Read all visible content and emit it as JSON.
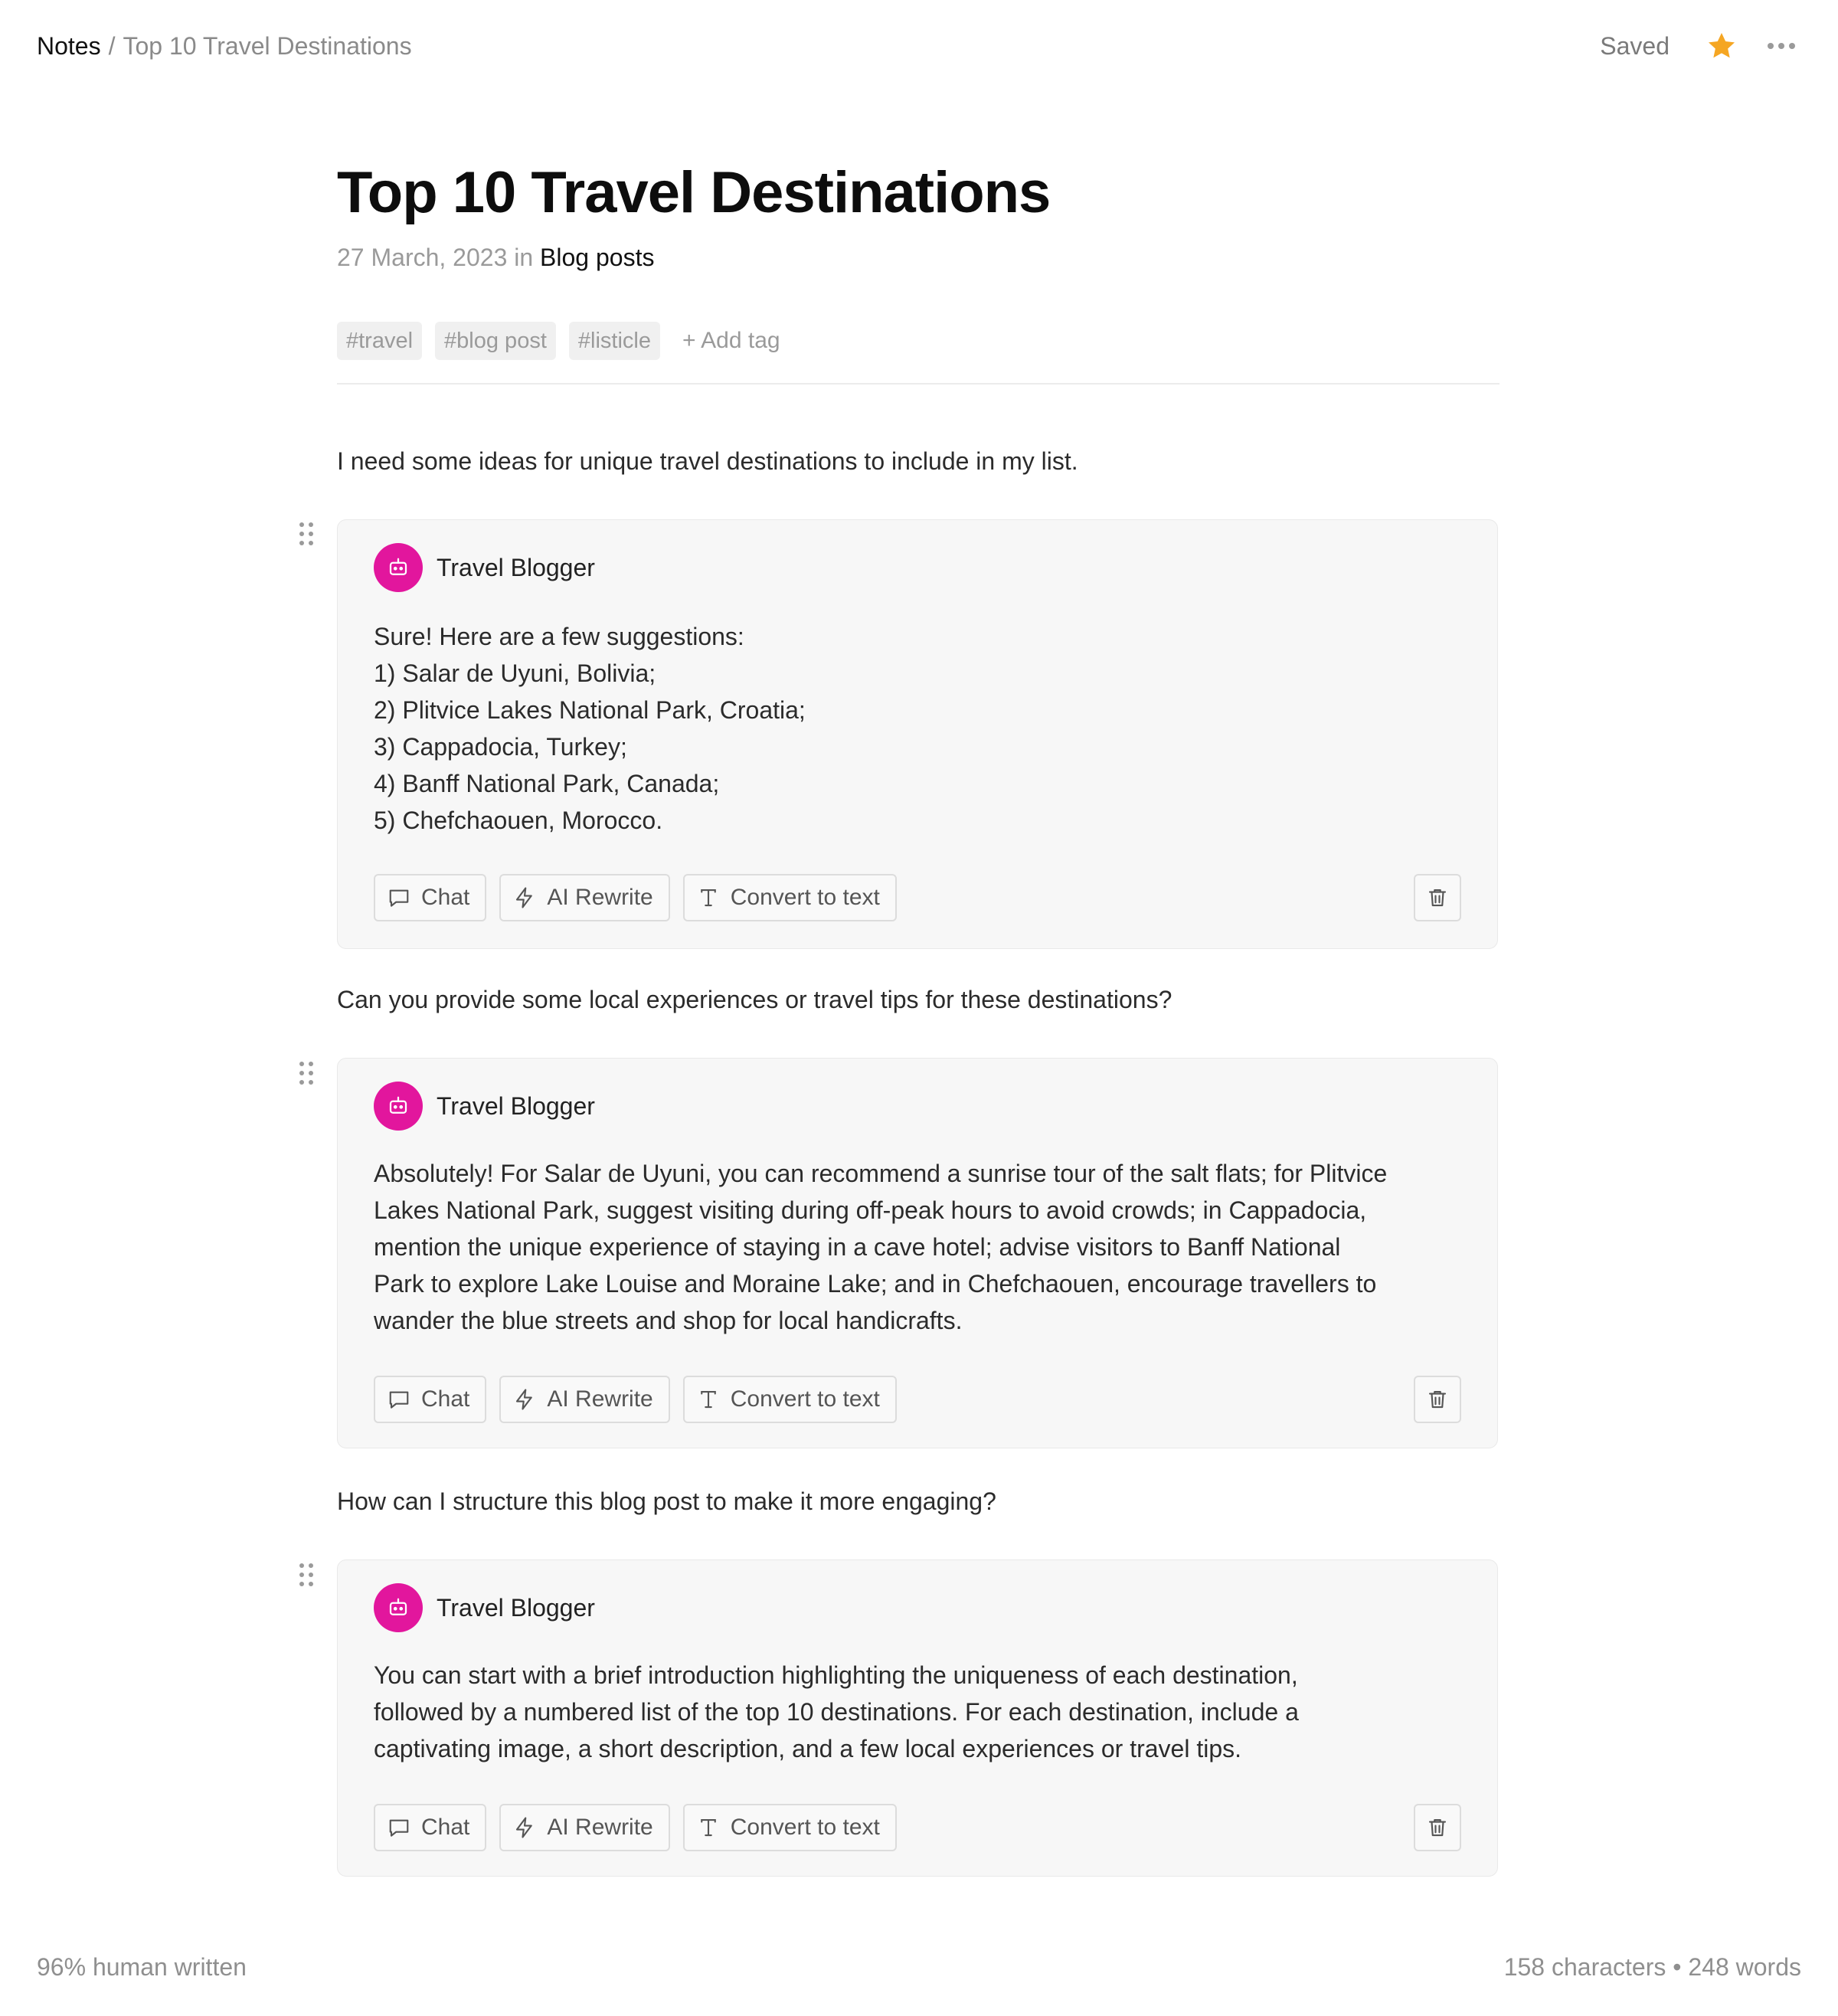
{
  "breadcrumb": {
    "root": "Notes",
    "separator": "/",
    "current": "Top 10 Travel Destinations"
  },
  "status": {
    "saved": "Saved",
    "starred": true,
    "star_color": "#F5A623"
  },
  "document": {
    "title": "Top 10 Travel Destinations",
    "date": "27 March, 2023",
    "in_word": "in",
    "category": "Blog posts",
    "tags": [
      "#travel",
      "#blog post",
      "#listicle"
    ],
    "add_tag": "+ Add tag"
  },
  "accent_color": "#E2169D",
  "blocks": [
    {
      "prompt": "I need some ideas for unique travel destinations to include in my list.",
      "bot_name": "Travel Blogger",
      "bot_icon": "robot-icon",
      "response_lines": [
        "Sure! Here are a few suggestions:",
        "1) Salar de Uyuni, Bolivia;",
        "2) Plitvice Lakes National Park, Croatia;",
        "3) Cappadocia, Turkey;",
        "4) Banff National Park, Canada;",
        "5) Chefchaouen, Morocco."
      ],
      "actions": {
        "chat": "Chat",
        "rewrite": "AI Rewrite",
        "convert": "Convert to text"
      }
    },
    {
      "prompt": "Can you provide some local experiences or travel tips for these destinations?",
      "bot_name": "Travel Blogger",
      "bot_icon": "robot-icon",
      "response_lines": [
        "Absolutely! For Salar de Uyuni, you can recommend a sunrise tour of the salt flats; for Plitvice",
        "Lakes National Park, suggest visiting during off-peak hours to avoid crowds; in Cappadocia,",
        "mention the unique experience of staying in a cave hotel; advise visitors to Banff National",
        "Park to explore Lake Louise and Moraine Lake; and in Chefchaouen, encourage travellers to",
        "wander the blue streets and shop for local handicrafts."
      ],
      "actions": {
        "chat": "Chat",
        "rewrite": "AI Rewrite",
        "convert": "Convert to text"
      }
    },
    {
      "prompt": "How can I structure this blog post to make it more engaging?",
      "bot_name": "Travel Blogger",
      "bot_icon": "robot-icon",
      "response_lines": [
        "You can start with a brief introduction highlighting the uniqueness of each destination,",
        "followed by a numbered list of the top 10 destinations. For each destination, include a",
        "captivating image, a short description, and a few local experiences or travel tips."
      ],
      "actions": {
        "chat": "Chat",
        "rewrite": "AI Rewrite",
        "convert": "Convert to text"
      }
    }
  ],
  "footer": {
    "human_written": "96% human written",
    "stats": "158 characters • 248 words"
  }
}
